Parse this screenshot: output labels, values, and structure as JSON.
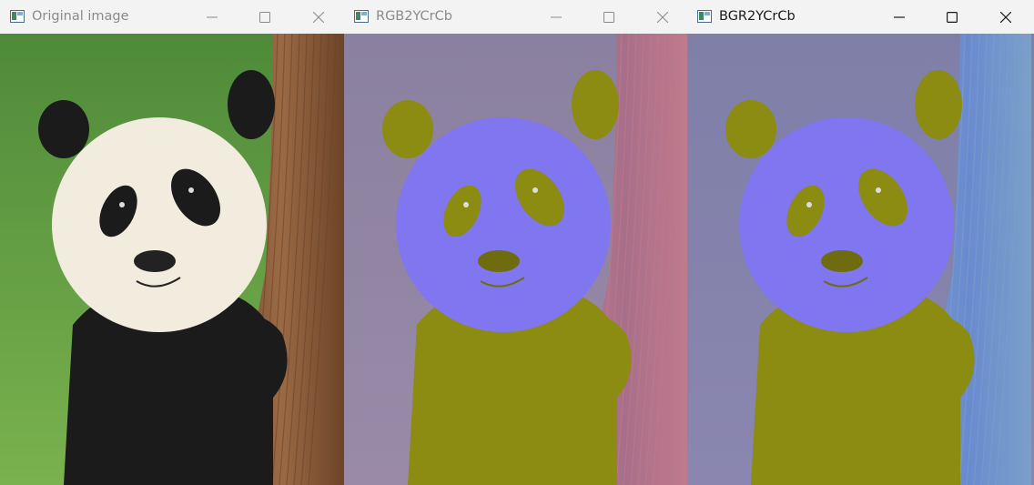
{
  "windows": [
    {
      "title": "Original image",
      "active": false,
      "palette": "original"
    },
    {
      "title": "RGB2YCrCb",
      "active": false,
      "palette": "rgb2ycrcb"
    },
    {
      "title": "BGR2YCrCb",
      "active": true,
      "palette": "bgr2ycrcb"
    }
  ],
  "icons": {
    "app": "window-app-icon",
    "minimize": "minimize-icon",
    "maximize": "maximize-icon",
    "close": "close-icon"
  },
  "palettes": {
    "original": {
      "bg": "#4f8a3a",
      "bg2": "#7ab24e",
      "trunk": "#9b6a45",
      "trunk2": "#6d4428",
      "white": "#f2ecdf",
      "black": "#1b1b1b",
      "nose": "#222222"
    },
    "rgb2ycrcb": {
      "bg": "#8a80a0",
      "bg2": "#9a8aa8",
      "trunk": "#a86f8a",
      "trunk2": "#c07a8c",
      "white": "#7f76f0",
      "black": "#8c8b12",
      "nose": "#6f6c10"
    },
    "bgr2ycrcb": {
      "bg": "#7f7fa8",
      "bg2": "#8a86b0",
      "trunk": "#6a8ad0",
      "trunk2": "#7aa0c8",
      "white": "#7f76f0",
      "black": "#8c8b12",
      "nose": "#6f6c10"
    }
  }
}
